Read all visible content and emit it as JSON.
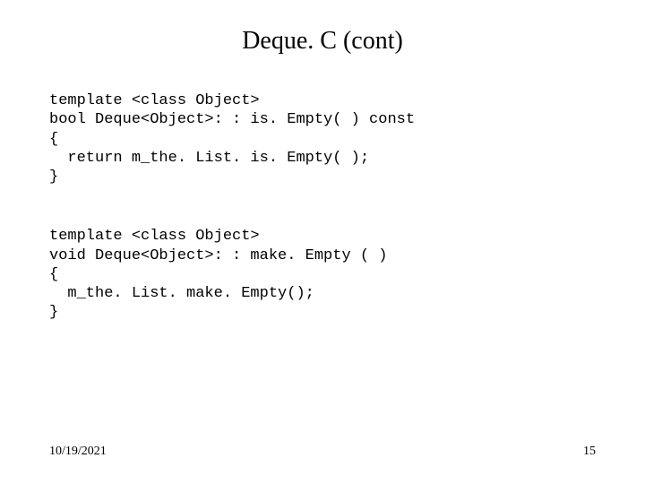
{
  "title": "Deque. C (cont)",
  "code_block_1": "template <class Object>\nbool Deque<Object>: : is. Empty( ) const\n{\n  return m_the. List. is. Empty( );\n}",
  "code_block_2": "template <class Object>\nvoid Deque<Object>: : make. Empty ( )\n{\n  m_the. List. make. Empty();\n}",
  "footer": {
    "date": "10/19/2021",
    "page": "15"
  }
}
